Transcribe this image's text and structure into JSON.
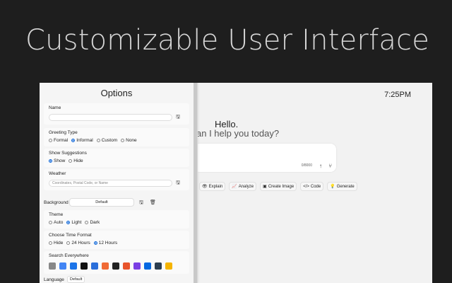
{
  "hero_title": "Customizable User Interface",
  "clock": "7:25PM",
  "greeting": {
    "title": "Hello.",
    "subtitle": "an I help you today?"
  },
  "chat": {
    "char_count": "0/8000",
    "send_icon": "arrow-up-icon",
    "branch_icon": "branch-icon"
  },
  "actions": [
    {
      "label": "Explain",
      "icon": "eye-icon",
      "glyph": "👁"
    },
    {
      "label": "Analyze",
      "icon": "chart-icon",
      "glyph": "📈"
    },
    {
      "label": "Create Image",
      "icon": "image-icon",
      "glyph": "▣"
    },
    {
      "label": "Code",
      "icon": "code-icon",
      "glyph": "</>"
    },
    {
      "label": "Generate",
      "icon": "bulb-icon",
      "glyph": "💡"
    }
  ],
  "options": {
    "title": "Options",
    "name": {
      "label": "Name",
      "value": ""
    },
    "greeting_type": {
      "label": "Greeting Type",
      "choices": [
        "Formal",
        "Informal",
        "Custom",
        "None"
      ],
      "selected": "Informal"
    },
    "show_suggestions": {
      "label": "Show Suggestions",
      "choices": [
        "Show",
        "Hide"
      ],
      "selected": "Show"
    },
    "weather": {
      "label": "Weather",
      "placeholder": "Coordinates, Postal Code, or Name"
    },
    "background": {
      "label": "Background",
      "value": "Default"
    },
    "theme": {
      "label": "Theme",
      "choices": [
        "Auto",
        "Light",
        "Dark"
      ],
      "selected": "Light"
    },
    "time_format": {
      "label": "Choose Time Format",
      "choices": [
        "Hide",
        "24 Hours",
        "12 Hours"
      ],
      "selected": "12 Hours"
    },
    "search_everywhere": {
      "label": "Search Everywhere",
      "engines": [
        {
          "name": "engine-1-icon",
          "color": "#888888"
        },
        {
          "name": "google-icon",
          "color": "#4285f4"
        },
        {
          "name": "bing-icon",
          "color": "#1a73e8"
        },
        {
          "name": "engine-4-icon",
          "color": "#111111"
        },
        {
          "name": "engine-5-icon",
          "color": "#2a6fdb"
        },
        {
          "name": "engine-6-icon",
          "color": "#f06a35"
        },
        {
          "name": "engine-7-icon",
          "color": "#222222"
        },
        {
          "name": "engine-8-icon",
          "color": "#e8542c"
        },
        {
          "name": "engine-9-icon",
          "color": "#7b3fe4"
        },
        {
          "name": "meta-icon",
          "color": "#0668e1"
        },
        {
          "name": "engine-11-icon",
          "color": "#2c3e50"
        },
        {
          "name": "engine-12-icon",
          "color": "#f5b400"
        }
      ]
    },
    "language": {
      "label": "Language",
      "value": "Default"
    }
  }
}
